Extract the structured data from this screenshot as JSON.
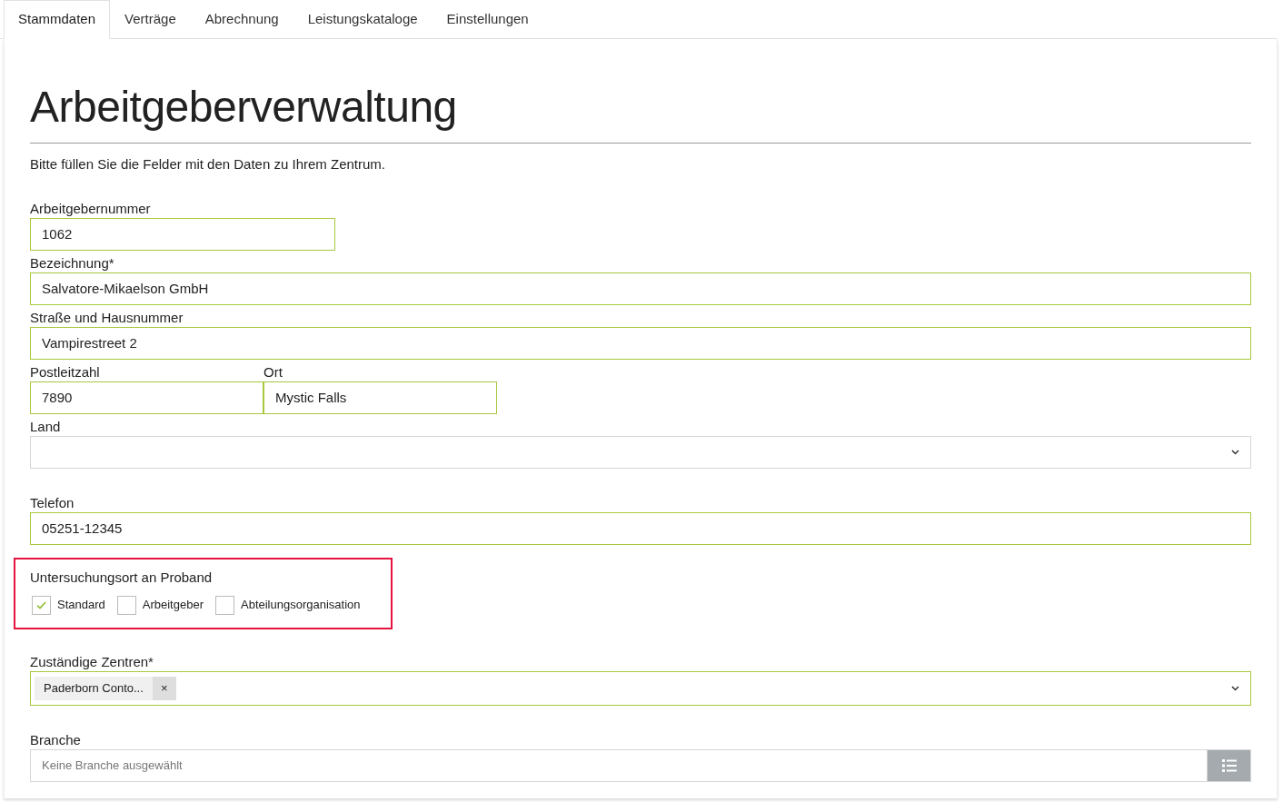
{
  "tabs": [
    {
      "label": "Stammdaten",
      "selected": true
    },
    {
      "label": "Verträge",
      "selected": false
    },
    {
      "label": "Abrechnung",
      "selected": false
    },
    {
      "label": "Leistungskataloge",
      "selected": false
    },
    {
      "label": "Einstellungen",
      "selected": false
    }
  ],
  "title": "Arbeitgeberverwaltung",
  "intro": "Bitte füllen Sie die Felder mit den Daten zu Ihrem Zentrum.",
  "fields": [
    {
      "kind": "short",
      "label": "Arbeitgebernummer",
      "value": "1062",
      "valid": true
    },
    {
      "kind": "text",
      "label": "Bezeichnung*",
      "value": "Salvatore-Mikaelson GmbH",
      "valid": true
    },
    {
      "kind": "text",
      "label": "Straße und Hausnummer",
      "value": "Vampirestreet 2",
      "valid": true
    },
    {
      "kind": "pair",
      "items": [
        {
          "label": "Postleitzahl",
          "value": "7890",
          "valid": true
        },
        {
          "label": "Ort",
          "value": "Mystic Falls",
          "valid": true
        }
      ]
    },
    {
      "kind": "select",
      "label": "Land",
      "valid": false
    },
    {
      "kind": "text",
      "label": "Telefon",
      "value": "05251-12345",
      "valid": true
    },
    {
      "kind": "checkgroup",
      "label": "Untersuchungsort an Proband",
      "highlighted": true,
      "options": [
        {
          "label": "Standard",
          "checked": true
        },
        {
          "label": "Arbeitgeber",
          "checked": false
        },
        {
          "label": "Abteilungsorganisation",
          "checked": false
        }
      ]
    },
    {
      "kind": "tags",
      "label": "Zuständige Zentren*",
      "valid": true,
      "tags": [
        {
          "label": "Paderborn Conto...",
          "remove": "×"
        }
      ]
    },
    {
      "kind": "picker",
      "label": "Branche",
      "placeholder": "Keine Branche ausgewählt",
      "valid": false
    }
  ]
}
